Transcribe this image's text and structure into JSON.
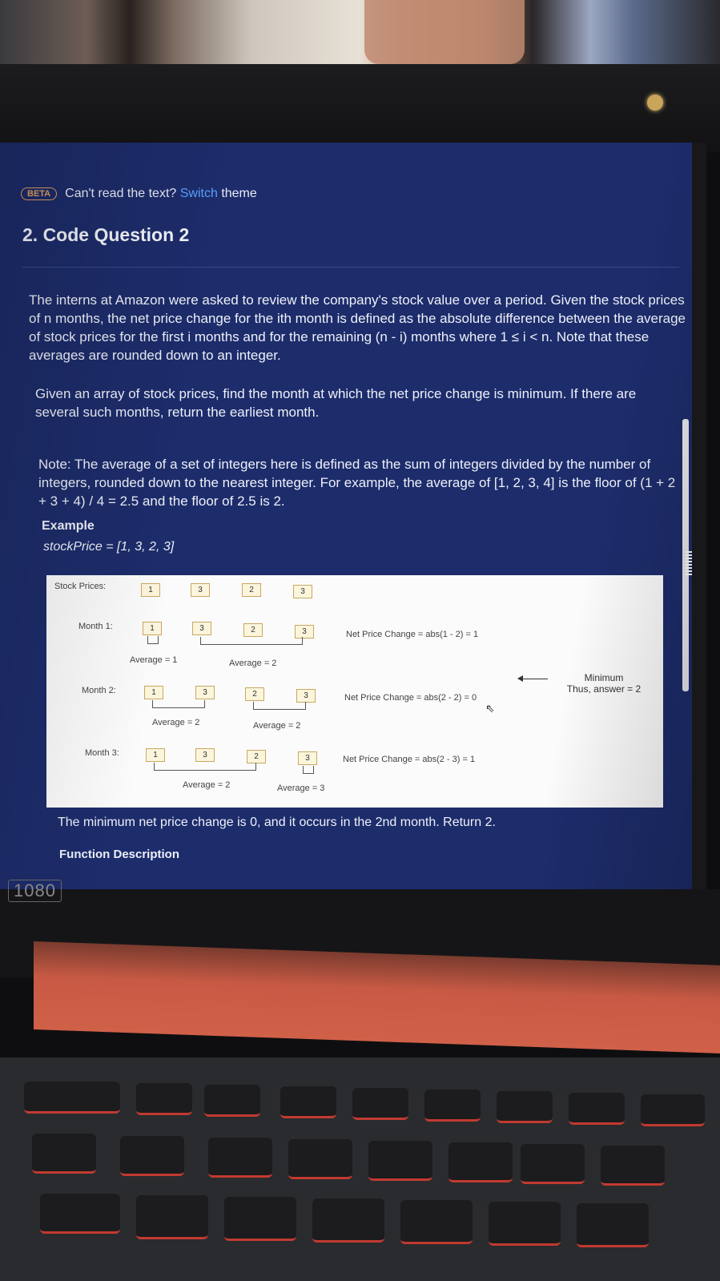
{
  "banner": {
    "beta_badge": "BETA",
    "prompt_text": "Can't read the text?",
    "switch_link": "Switch",
    "theme_text": "theme"
  },
  "question": {
    "title": "2. Code Question 2",
    "paragraph1": "The interns at Amazon were asked to review the company's stock value over a period. Given the stock prices of n months, the net price change for the ith month is defined as the absolute difference between the average of stock prices for the first i months and for the remaining (n - i) months where 1 ≤ i < n. Note that these averages are rounded down to an integer.",
    "paragraph2": "Given an array of stock prices, find the month at which the net price change is minimum. If there are several such months, return the earliest month.",
    "paragraph3": "Note: The average of a set of integers here is defined as the sum of integers divided by the number of integers, rounded down to the nearest integer. For example, the average of [1, 2, 3, 4] is the floor of (1 + 2 + 3 + 4) / 4 = 2.5 and the floor of 2.5 is 2.",
    "example_heading": "Example",
    "example_value": "stockPrice = [1, 3, 2, 3]"
  },
  "diagram": {
    "stock_label": "Stock Prices:",
    "prices": [
      "1",
      "3",
      "2",
      "3"
    ],
    "months": [
      {
        "label": "Month 1:",
        "avg_left": "Average = 1",
        "avg_right": "Average = 2",
        "net": "Net Price Change = abs(1 - 2) = 1"
      },
      {
        "label": "Month 2:",
        "avg_left": "Average = 2",
        "avg_right": "Average = 2",
        "net": "Net Price Change = abs(2 - 2) = 0"
      },
      {
        "label": "Month 3:",
        "avg_left": "Average = 2",
        "avg_right": "Average = 3",
        "net": "Net Price Change = abs(2 - 3) = 1"
      }
    ],
    "minimum_label": "Minimum",
    "answer_label": "Thus, answer = 2"
  },
  "conclusion": "The minimum net price change is 0, and it occurs in the 2nd month. Return 2.",
  "function_description": "Function Description",
  "laptop_badge": "1080",
  "colors": {
    "screen_bg": "#1d2c6b",
    "link": "#5aa2ff",
    "beta": "#e0a060",
    "cell_border": "#c9a860"
  }
}
